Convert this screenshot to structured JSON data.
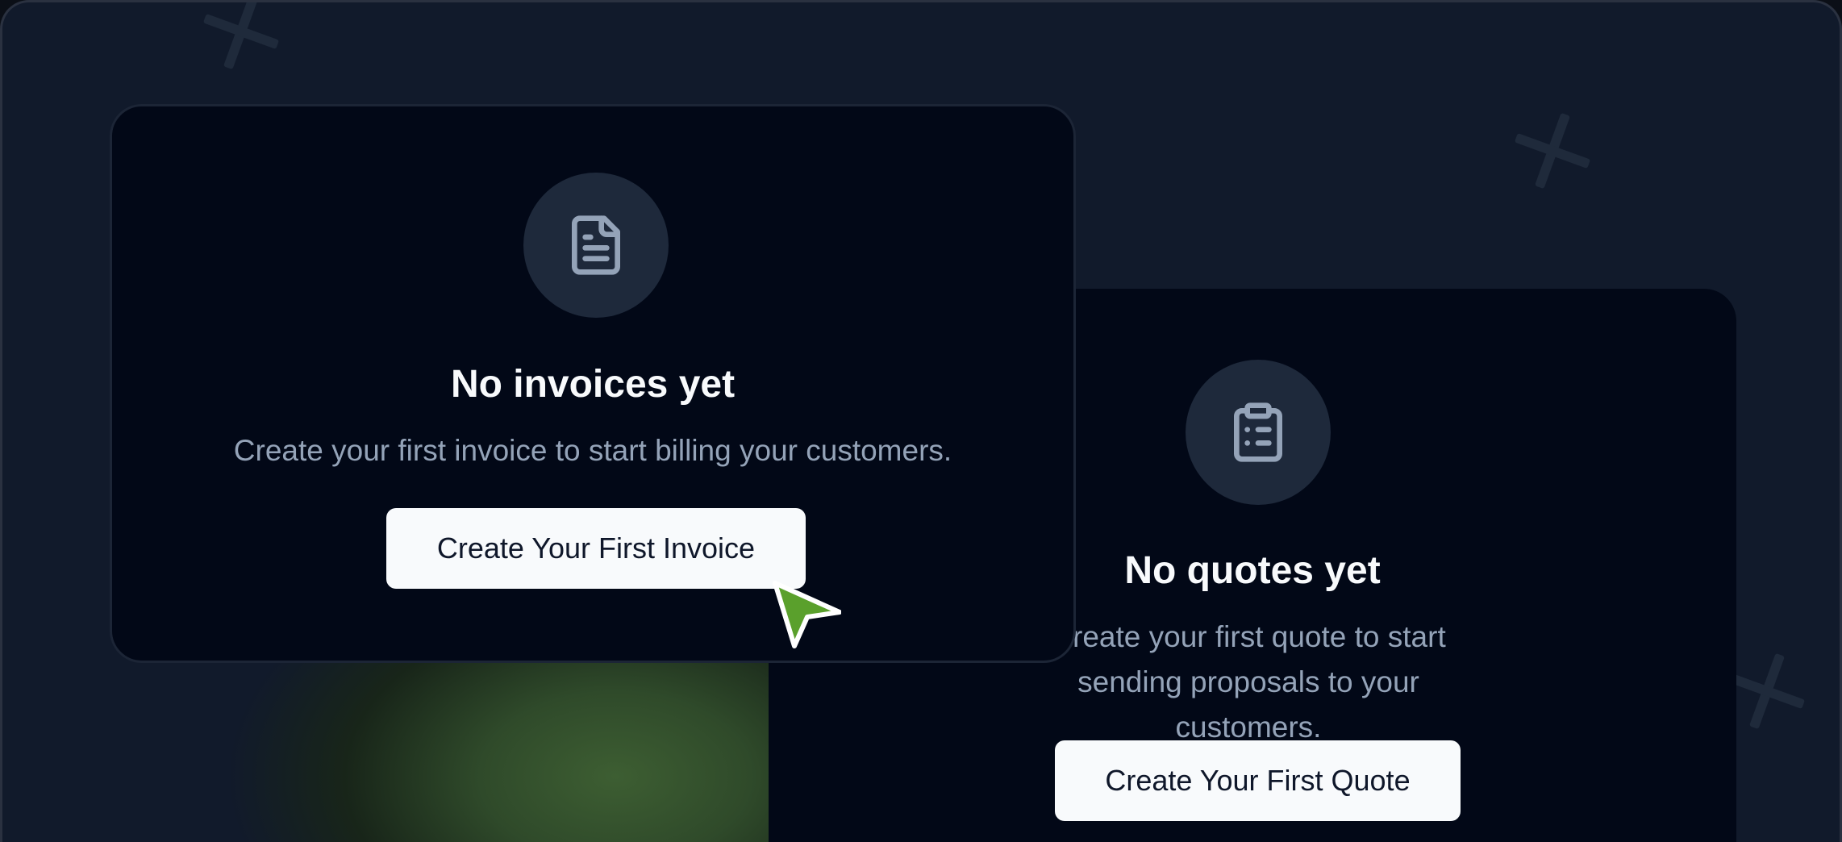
{
  "invoices_empty": {
    "icon": "file-text-icon",
    "title": "No invoices yet",
    "description": "Create your first invoice to start billing your customers.",
    "button_label": "Create Your First Invoice"
  },
  "quotes_empty": {
    "icon": "clipboard-list-icon",
    "title": "No quotes yet",
    "description": "Create your first quote to start sending proposals to your customers.",
    "button_label": "Create Your First Quote"
  },
  "colors": {
    "background": "#111a2b",
    "card": "#020817",
    "icon_circle": "#1e293b",
    "button": "#f8fafc",
    "title": "#f8fafc",
    "description": "#94a3b8",
    "cursor": "#5aa02c"
  },
  "cursor_icon": "pointer-cursor-icon"
}
